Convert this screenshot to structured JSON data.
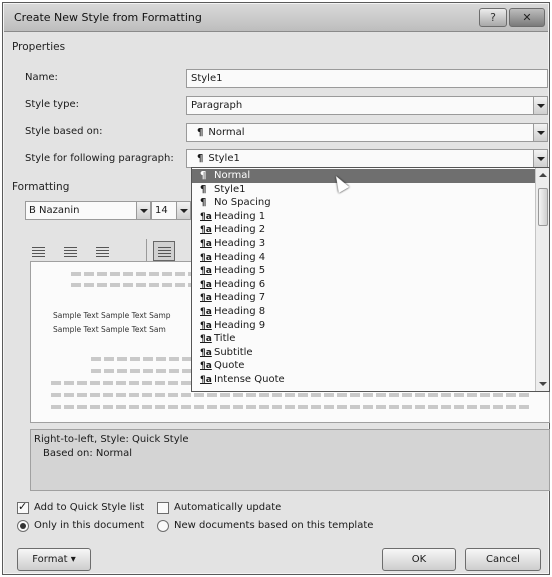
{
  "window": {
    "title": "Create New Style from Formatting",
    "help_label": "?",
    "close_label": "✕"
  },
  "properties": {
    "section_title": "Properties",
    "name_label": "Name:",
    "name_value": "Style1",
    "style_type_label": "Style type:",
    "style_type_value": "Paragraph",
    "based_on_label": "Style based on:",
    "based_on_value": "Normal",
    "following_label": "Style for following paragraph:",
    "following_value": "Style1"
  },
  "formatting": {
    "section_title": "Formatting",
    "font_name": "B Nazanin",
    "font_size": "14",
    "sample_lines": [
      "Sample Text Sample Text Samp",
      "Sample Text Sample Text Sam"
    ]
  },
  "dropdown": {
    "items": [
      {
        "label": "Normal",
        "icon": "paragraph",
        "selected": true
      },
      {
        "label": "Style1",
        "icon": "paragraph",
        "selected": false
      },
      {
        "label": "No Spacing",
        "icon": "paragraph",
        "selected": false
      },
      {
        "label": "Heading 1",
        "icon": "linked-style",
        "selected": false
      },
      {
        "label": "Heading 2",
        "icon": "linked-style",
        "selected": false
      },
      {
        "label": "Heading 3",
        "icon": "linked-style",
        "selected": false
      },
      {
        "label": "Heading 4",
        "icon": "linked-style",
        "selected": false
      },
      {
        "label": "Heading 5",
        "icon": "linked-style",
        "selected": false
      },
      {
        "label": "Heading 6",
        "icon": "linked-style",
        "selected": false
      },
      {
        "label": "Heading 7",
        "icon": "linked-style",
        "selected": false
      },
      {
        "label": "Heading 8",
        "icon": "linked-style",
        "selected": false
      },
      {
        "label": "Heading 9",
        "icon": "linked-style",
        "selected": false
      },
      {
        "label": "Title",
        "icon": "linked-style",
        "selected": false
      },
      {
        "label": "Subtitle",
        "icon": "linked-style",
        "selected": false
      },
      {
        "label": "Quote",
        "icon": "linked-style",
        "selected": false
      },
      {
        "label": "Intense Quote",
        "icon": "linked-style",
        "selected": false
      }
    ]
  },
  "description": {
    "line1": "Right-to-left, Style: Quick Style",
    "line2": "Based on: Normal"
  },
  "options": {
    "add_quick_style_label": "Add to Quick Style list",
    "add_quick_style_checked": true,
    "auto_update_label": "Automatically update",
    "auto_update_checked": false,
    "only_this_doc_label": "Only in this document",
    "only_this_doc_selected": true,
    "new_docs_label": "New documents based on this template",
    "new_docs_selected": false
  },
  "buttons": {
    "format_label": "Format ▾",
    "ok_label": "OK",
    "cancel_label": "Cancel"
  }
}
